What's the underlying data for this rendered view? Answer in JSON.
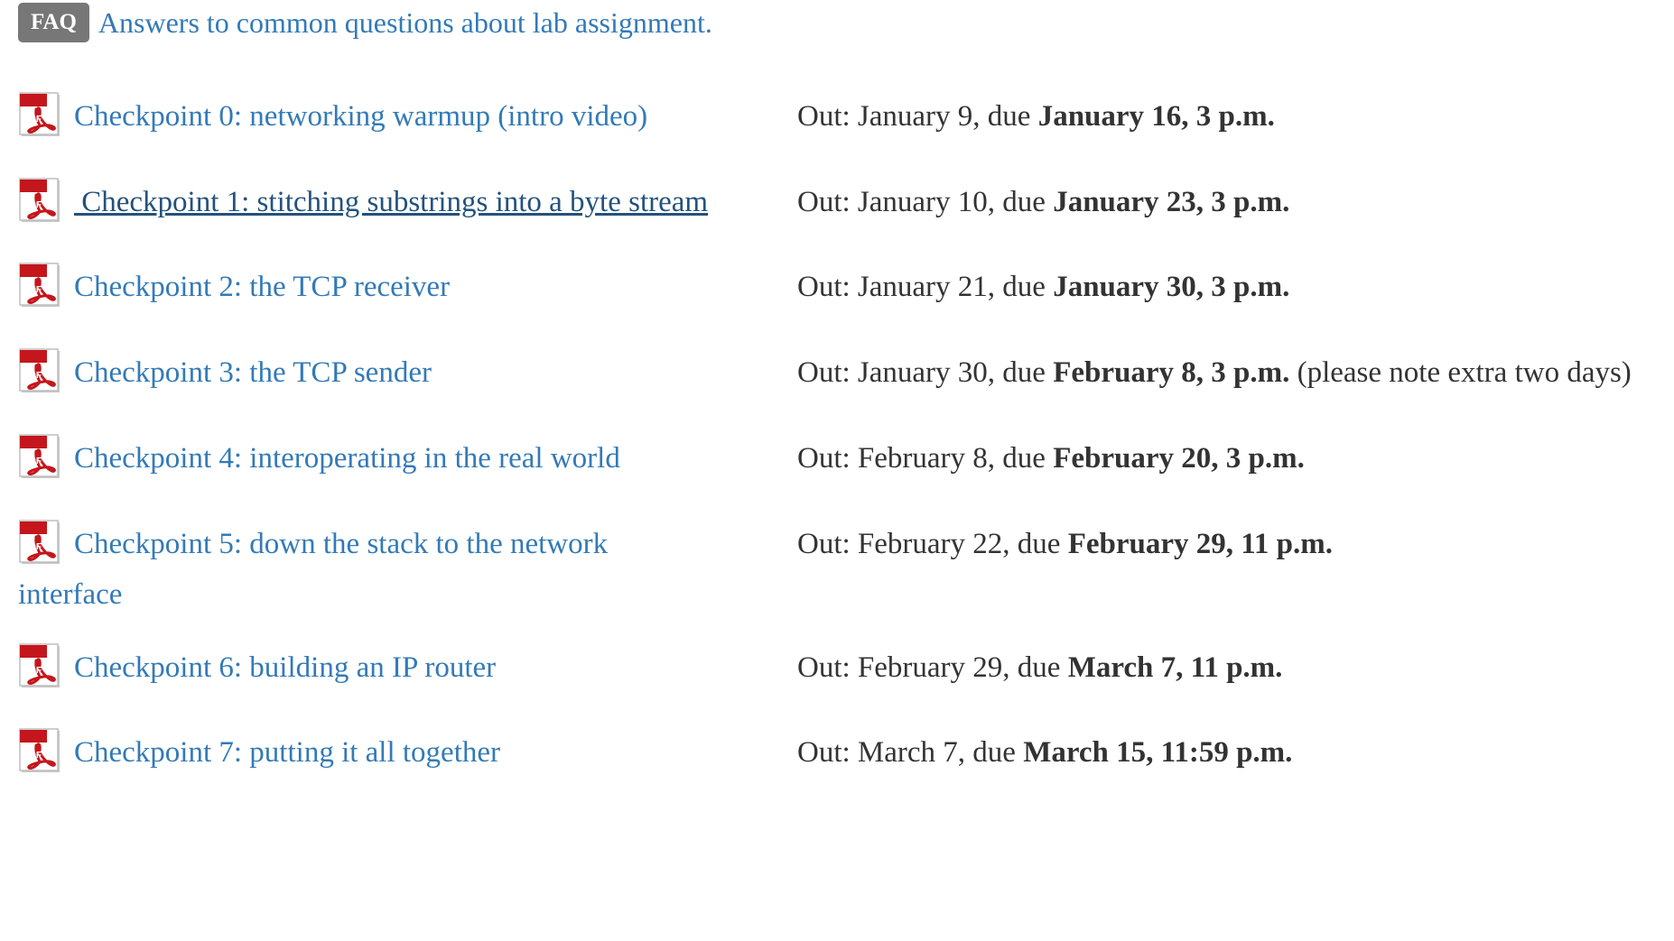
{
  "faq": {
    "badge": "FAQ",
    "link_text": "Answers to common questions about lab assignment."
  },
  "pdf_icon_label": "PDF",
  "checkpoints": [
    {
      "title": "Checkpoint 0: networking warmup",
      "extra_open": " (",
      "extra_link": "intro video",
      "extra_close": ")",
      "out_text": "Out: January 9, due ",
      "due_bold": "January 16, 3 p.m.",
      "note": ""
    },
    {
      "title": " Checkpoint 1: stitching substrings into a byte stream",
      "out_text": "Out: January 10, due ",
      "due_bold": "January 23, 3 p.m.",
      "note": ""
    },
    {
      "title": "Checkpoint 2: the TCP receiver",
      "out_text": "Out: January 21, due ",
      "due_bold": "January 30, 3 p.m.",
      "note": ""
    },
    {
      "title": "Checkpoint 3: the TCP sender",
      "out_text": "Out: January 30, due ",
      "due_bold": "February 8, 3 p.m.",
      "note": " (please note extra two days)"
    },
    {
      "title": "Checkpoint 4: interoperating in the real world",
      "out_text": "Out: February 8, due ",
      "due_bold": "February 20, 3 p.m.",
      "note": ""
    },
    {
      "title": "Checkpoint 5: down the stack to the network interface",
      "out_text": "Out: February 22, due ",
      "due_bold": "February 29, 11 p.m.",
      "note": ""
    },
    {
      "title": "Checkpoint 6: building an IP router",
      "out_text": "Out: February 29, due ",
      "due_bold": "March 7, 11 p.m.",
      "note": ""
    },
    {
      "title": "Checkpoint 7: putting it all together",
      "out_text": "Out: March 7, due ",
      "due_bold": "March 15, 11:59 p.m.",
      "note": ""
    }
  ]
}
